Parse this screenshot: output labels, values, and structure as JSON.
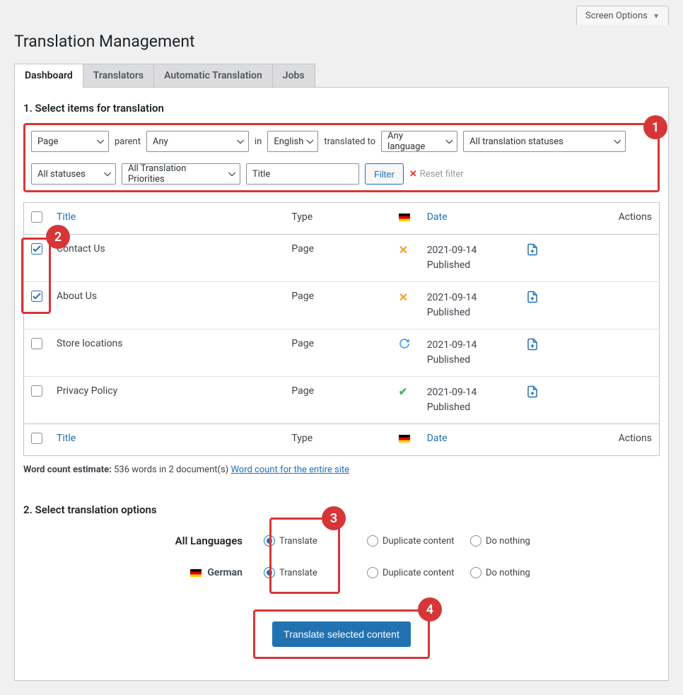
{
  "screen_options": "Screen Options",
  "page_title": "Translation Management",
  "tabs": [
    "Dashboard",
    "Translators",
    "Automatic Translation",
    "Jobs"
  ],
  "step1_title": "1. Select items for translation",
  "filters": {
    "post_type": "Page",
    "parent_label": "parent",
    "parent": "Any",
    "in_label": "in",
    "lang": "English",
    "translated_to_label": "translated to",
    "to_lang": "Any language",
    "translation_status": "All translation statuses",
    "status": "All statuses",
    "priority": "All Translation Priorities",
    "title_placeholder": "Title",
    "filter_btn": "Filter",
    "reset": "Reset filter"
  },
  "columns": {
    "title": "Title",
    "type": "Type",
    "date": "Date",
    "actions": "Actions"
  },
  "rows": [
    {
      "title": "Contact Us",
      "type": "Page",
      "status": "x",
      "date": "2021-09-14",
      "state": "Published",
      "checked": true
    },
    {
      "title": "About Us",
      "type": "Page",
      "status": "x",
      "date": "2021-09-14",
      "state": "Published",
      "checked": true
    },
    {
      "title": "Store locations",
      "type": "Page",
      "status": "refresh",
      "date": "2021-09-14",
      "state": "Published",
      "checked": false
    },
    {
      "title": "Privacy Policy",
      "type": "Page",
      "status": "check",
      "date": "2021-09-14",
      "state": "Published",
      "checked": false
    }
  ],
  "word_count_prefix": "Word count estimate:",
  "word_count_text": "536 words in 2 document(s)",
  "word_count_link": "Word count for the entire site",
  "step2_title": "2. Select translation options",
  "options": {
    "all_label": "All Languages",
    "german_label": "German",
    "translate": "Translate",
    "duplicate": "Duplicate content",
    "nothing": "Do nothing"
  },
  "submit": "Translate selected content",
  "annotations": {
    "a1": "1",
    "a2": "2",
    "a3": "3",
    "a4": "4"
  }
}
